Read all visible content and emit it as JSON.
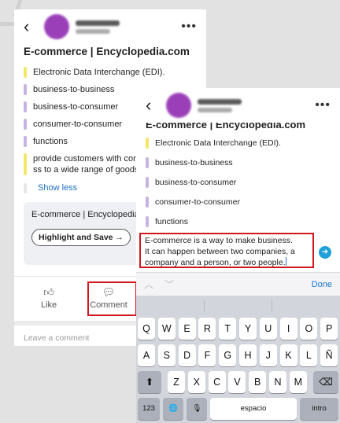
{
  "left": {
    "header": {
      "more_icon": "more-horizontal-icon",
      "back_icon": "chevron-left-icon"
    },
    "title": "E-commerce | Encyclopedia.com",
    "highlights": [
      {
        "text": "Electronic Data Interchange (EDI).",
        "color": "#f1e86a"
      },
      {
        "text": "business-to-business",
        "color": "#c6b3e0"
      },
      {
        "text": "business-to-consumer",
        "color": "#c6b3e0"
      },
      {
        "text": "consumer-to-consumer",
        "color": "#c6b3e0"
      },
      {
        "text": "functions",
        "color": "#c6b3e0"
      },
      {
        "text": "provide customers with conve\nss to a wide range of goods ar",
        "color": "#f1e86a"
      }
    ],
    "show_less": "Show less",
    "source_title": "E-commerce | Encyclopedia.co",
    "highlight_save": "Highlight and Save →",
    "like_label": "Like",
    "comment_label": "Comment",
    "leave_comment": "Leave a comment"
  },
  "right": {
    "header": {
      "more_icon": "more-horizontal-icon",
      "back_icon": "chevron-left-icon"
    },
    "cut_title": "E-commerce | Encyclopedia.com",
    "highlights": [
      {
        "text": "Electronic Data Interchange (EDI).",
        "color": "#f1e86a"
      },
      {
        "text": "business-to-business",
        "color": "#c6b3e0"
      },
      {
        "text": "business-to-consumer",
        "color": "#c6b3e0"
      },
      {
        "text": "consumer-to-consumer",
        "color": "#c6b3e0"
      },
      {
        "text": "functions",
        "color": "#c6b3e0"
      }
    ],
    "comment_text": "E-commerce is a way to make business.\nIt can happen between two companies, a\ncompany and a person, or two people.",
    "done": "Done",
    "keyboard": {
      "row1": [
        "Q",
        "W",
        "E",
        "R",
        "T",
        "Y",
        "U",
        "I",
        "O",
        "P"
      ],
      "row2": [
        "A",
        "S",
        "D",
        "F",
        "G",
        "H",
        "J",
        "K",
        "L",
        "Ñ"
      ],
      "row3": [
        "Z",
        "X",
        "C",
        "V",
        "B",
        "N",
        "M"
      ],
      "shift": "⬆",
      "delete": "⌫",
      "numbers": "123",
      "globe": "🌐",
      "mic": "🎙",
      "space": "espacio",
      "enter": "intro"
    }
  }
}
